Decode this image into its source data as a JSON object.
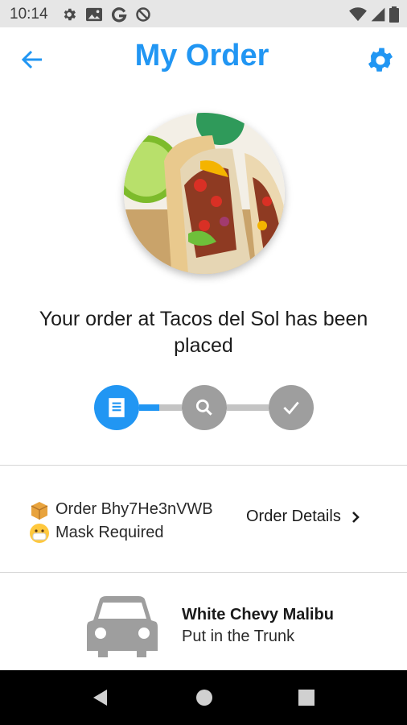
{
  "status_bar": {
    "time": "10:14",
    "left_icons": [
      "gear-icon",
      "image-icon",
      "google-icon",
      "at-sign-icon"
    ],
    "right_icons": [
      "wifi-icon",
      "signal-icon",
      "battery-icon"
    ]
  },
  "header": {
    "title": "My Order",
    "back_icon": "arrow-left-icon",
    "settings_icon": "gear-icon"
  },
  "colors": {
    "accent": "#2196f3",
    "inactive_step": "#9e9e9e",
    "inactive_bar": "#c4c4c4"
  },
  "order": {
    "message": "Your order at Tacos del Sol has been placed",
    "progress": {
      "current_step": 1,
      "steps": [
        {
          "icon": "receipt-icon",
          "state": "active"
        },
        {
          "icon": "search-icon",
          "state": "pending"
        },
        {
          "icon": "check-icon",
          "state": "pending"
        }
      ]
    },
    "order_id_text": "Order Bhy7He3nVWB",
    "mask_text": "Mask Required",
    "details_label": "Order Details"
  },
  "vehicle": {
    "name": "White Chevy Malibu",
    "instruction": "Put in the Trunk"
  },
  "nav": [
    "back-icon",
    "home-icon",
    "recents-icon"
  ]
}
